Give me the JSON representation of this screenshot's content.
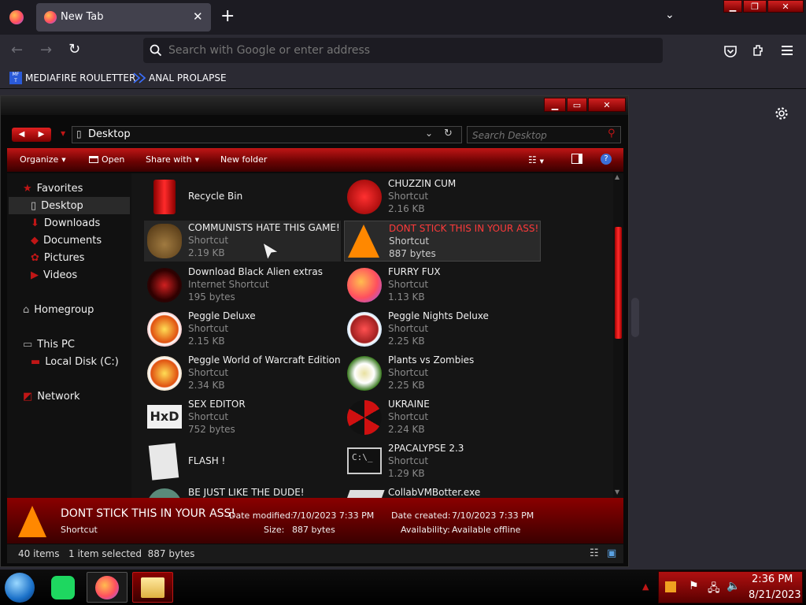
{
  "browser": {
    "tab_title": "New Tab",
    "url_placeholder": "Search with Google or enter address",
    "bookmarks": [
      {
        "label": "MEDIAFIRE ROULETTER",
        "icon": "mediafire-icon"
      },
      {
        "label": "ANAL PROLAPSE",
        "icon": "bookmark-icon"
      }
    ]
  },
  "explorer": {
    "address": "Desktop",
    "search_placeholder": "Search Desktop",
    "commands": {
      "organize": "Organize",
      "open": "Open",
      "share": "Share with",
      "new_folder": "New folder"
    },
    "nav": {
      "favorites": "Favorites",
      "desktop": "Desktop",
      "downloads": "Downloads",
      "documents": "Documents",
      "pictures": "Pictures",
      "videos": "Videos",
      "homegroup": "Homegroup",
      "this_pc": "This PC",
      "local_disk": "Local Disk (C:)",
      "network": "Network"
    },
    "files": [
      {
        "name": "Recycle Bin",
        "type": "",
        "size": ""
      },
      {
        "name": "CHUZZIN CUM",
        "type": "Shortcut",
        "size": "2.16 KB"
      },
      {
        "name": "COMMUNISTS HATE THIS GAME!",
        "type": "Shortcut",
        "size": "2.19 KB"
      },
      {
        "name": "DONT STICK THIS IN YOUR ASS!",
        "type": "Shortcut",
        "size": "887 bytes"
      },
      {
        "name": "Download Black Alien extras",
        "type": "Internet Shortcut",
        "size": "195 bytes"
      },
      {
        "name": "FURRY FUX",
        "type": "Shortcut",
        "size": "1.13 KB"
      },
      {
        "name": "Peggle Deluxe",
        "type": "Shortcut",
        "size": "2.15 KB"
      },
      {
        "name": "Peggle Nights Deluxe",
        "type": "Shortcut",
        "size": "2.25 KB"
      },
      {
        "name": "Peggle World of Warcraft Edition",
        "type": "Shortcut",
        "size": "2.34 KB"
      },
      {
        "name": "Plants vs Zombies",
        "type": "Shortcut",
        "size": "2.25 KB"
      },
      {
        "name": "SEX EDITOR",
        "type": "Shortcut",
        "size": "752 bytes"
      },
      {
        "name": "UKRAINE",
        "type": "Shortcut",
        "size": "2.24 KB"
      },
      {
        "name": "FLASH !",
        "type": "",
        "size": ""
      },
      {
        "name": "2PACALYPSE 2.3",
        "type": "Shortcut",
        "size": "1.29 KB"
      },
      {
        "name": "BE JUST LIKE THE DUDE!",
        "type": "",
        "size": ""
      },
      {
        "name": "CollabVMBotter.exe",
        "type": "",
        "size": ""
      }
    ],
    "details": {
      "name": "DONT STICK THIS IN YOUR ASS!",
      "type": "Shortcut",
      "modified_label": "Date modified:",
      "modified": "7/10/2023 7:33 PM",
      "size_label": "Size:",
      "size": "887 bytes",
      "created_label": "Date created:",
      "created": "7/10/2023 7:33 PM",
      "availability_label": "Availability:",
      "availability": "Available offline"
    },
    "status": {
      "items": "40 items",
      "selected": "1 item selected  887 bytes"
    }
  },
  "taskbar": {
    "time": "2:36 PM",
    "date": "8/21/2023"
  },
  "colors": {
    "accent": "#c01616",
    "highlight_text": "#ff3a3a"
  }
}
